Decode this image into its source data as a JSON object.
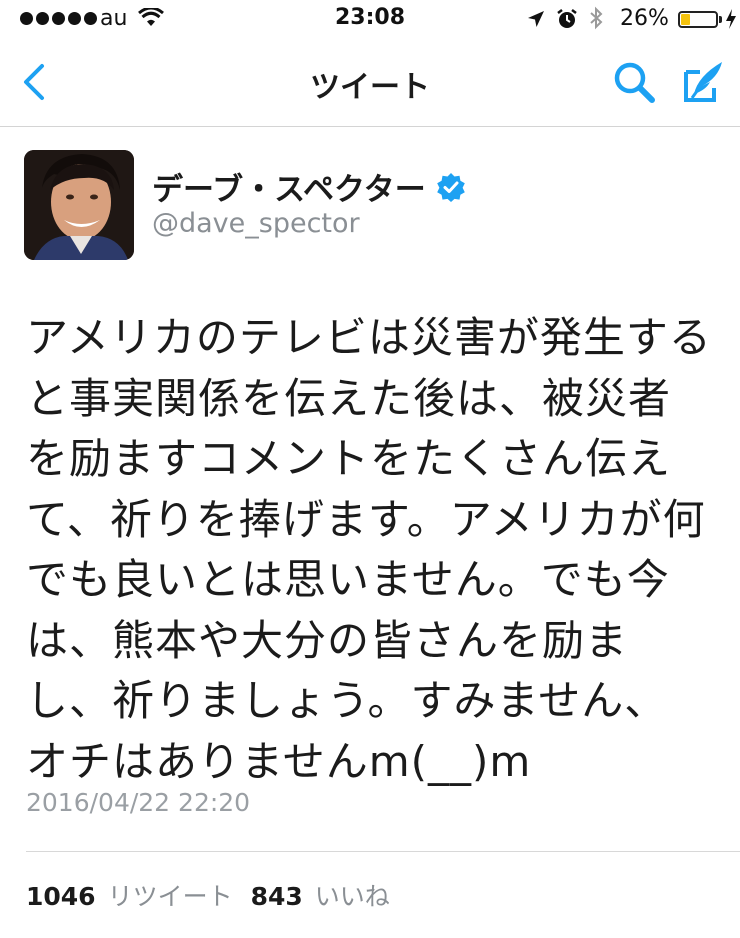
{
  "status_bar": {
    "carrier": "au",
    "time": "23:08",
    "battery_percent": "26%",
    "battery_level": 0.26,
    "signal_bars": 5,
    "icons": [
      "wifi-icon",
      "location-arrow-icon",
      "alarm-icon",
      "bluetooth-icon",
      "battery-icon",
      "charging-icon"
    ]
  },
  "nav": {
    "title": "ツイート",
    "accent": "#1da1f2",
    "icons": [
      "back-chevron-icon",
      "search-icon",
      "compose-icon"
    ]
  },
  "user": {
    "name": "デーブ・スペクター",
    "handle": "@dave_spector",
    "verified": true
  },
  "tweet": {
    "lines": [
      "アメリカのテレビは災害が発生する",
      "と事実関係を伝えた後は、被災者",
      "を励ますコメントをたくさん伝え",
      "て、祈りを捧げます。アメリカが何",
      "でも良いとは思いません。でも今",
      "は、熊本や大分の皆さんを励ま",
      "し、祈りましょう。すみません、",
      "オチはありませんm(__)m"
    ],
    "timestamp": "2016/04/22 22:20",
    "retweet_count": "1046",
    "retweet_label": "リツイート",
    "like_count": "843",
    "like_label": "いいね"
  }
}
